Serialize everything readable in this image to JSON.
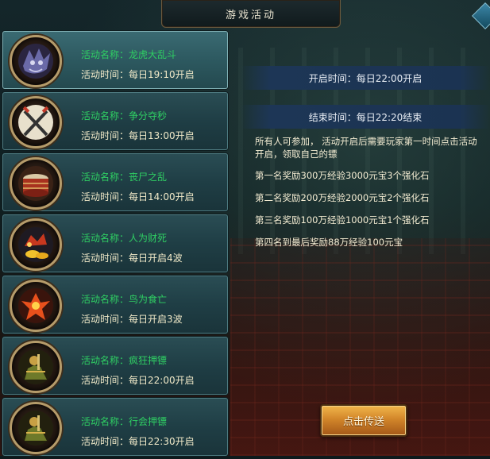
{
  "window": {
    "title": "游戏活动"
  },
  "activities": [
    {
      "name_label": "活动名称：",
      "name": "龙虎大乱斗",
      "time_label": "活动时间：",
      "time": "每日19:10开启",
      "icon": "dragon-icon",
      "active": true
    },
    {
      "name_label": "活动名称：",
      "name": "争分夺秒",
      "time_label": "活动时间：",
      "time": "每日13:00开启",
      "icon": "crossed-swords-icon",
      "active": false
    },
    {
      "name_label": "活动名称：",
      "name": "丧尸之乱",
      "time_label": "活动时间：",
      "time": "每日14:00开启",
      "icon": "war-drum-icon",
      "active": false
    },
    {
      "name_label": "活动名称：",
      "name": "人为财死",
      "time_label": "活动时间：",
      "time": "每日开启4波",
      "icon": "treasure-beast-icon",
      "active": false
    },
    {
      "name_label": "活动名称：",
      "name": "鸟为食亡",
      "time_label": "活动时间：",
      "time": "每日开启3波",
      "icon": "fire-bird-icon",
      "active": false
    },
    {
      "name_label": "活动名称：",
      "name": "疯狂押镖",
      "time_label": "活动时间：",
      "time": "每日22:00开启",
      "icon": "escort-rider-icon",
      "active": false
    },
    {
      "name_label": "活动名称：",
      "name": "行会押镖",
      "time_label": "活动时间：",
      "time": "每日22:30开启",
      "icon": "escort-rider-icon",
      "active": false
    }
  ],
  "detail": {
    "open_time": "开启时间：每日22:00开启",
    "close_time": "结束时间：每日22:20结束",
    "intro": "所有人可参加，  活动开启后需要玩家第一时间点击活动开启，领取自己的镖",
    "rewards": [
      "第一名奖励300万经验3000元宝3个强化石",
      "第二名奖励200万经验2000元宝2个强化石",
      "第三名奖励100万经验1000元宝1个强化石",
      "第四名到最后奖励88万经验100元宝"
    ],
    "button_label": "点击传送"
  }
}
